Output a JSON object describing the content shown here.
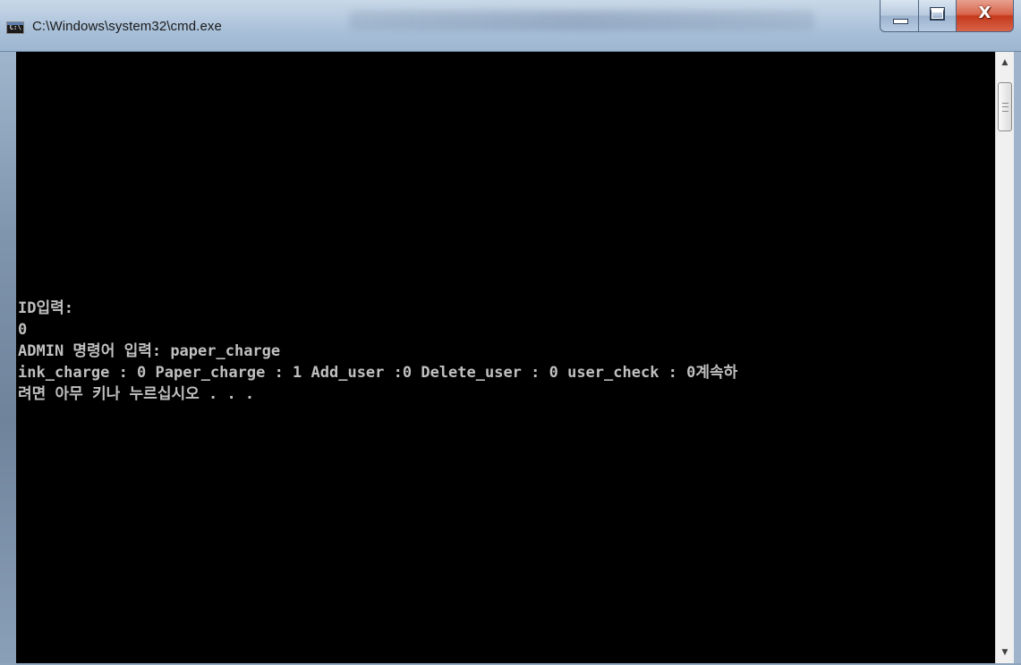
{
  "window": {
    "title": "C:\\Windows\\system32\\cmd.exe",
    "icon_label": "C:\\",
    "icon": "console-app-icon",
    "controls": {
      "minimize_icon": "minimize-icon",
      "maximize_icon": "maximize-icon",
      "close_icon": "close-icon",
      "close_glyph": "X"
    }
  },
  "console": {
    "background_color": "#000000",
    "text_color": "#c0c0c0",
    "lines": [
      "ID입력:",
      "0",
      "ADMIN 명령어 입력: paper_charge",
      "ink_charge : 0 Paper_charge : 1 Add_user :0 Delete_user : 0 user_check : 0계속하",
      "려면 아무 키나 누르십시오 . . ."
    ]
  },
  "scrollbar": {
    "up_arrow": "▲",
    "down_arrow": "▼"
  }
}
